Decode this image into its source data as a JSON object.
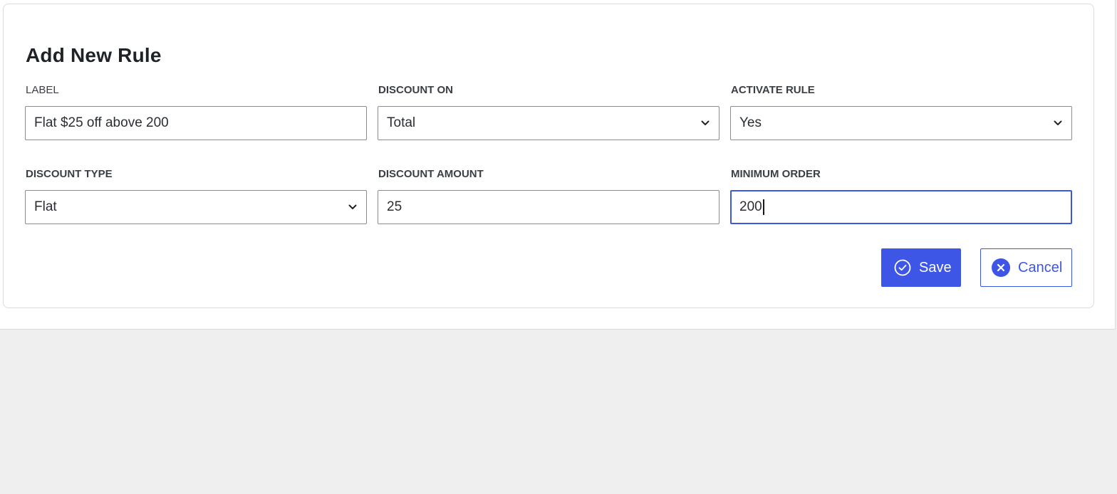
{
  "form": {
    "title": "Add New Rule",
    "fields": {
      "label": {
        "label": "LABEL",
        "value": "Flat $25 off above 200"
      },
      "discount_on": {
        "label": "DISCOUNT ON",
        "value": "Total"
      },
      "activate_rule": {
        "label": "ACTIVATE RULE",
        "value": "Yes"
      },
      "discount_type": {
        "label": "DISCOUNT TYPE",
        "value": "Flat"
      },
      "discount_amount": {
        "label": "DISCOUNT AMOUNT",
        "value": "25"
      },
      "minimum_order": {
        "label": "MINIMUM ORDER",
        "value": "200"
      }
    },
    "actions": {
      "save_label": "Save",
      "cancel_label": "Cancel"
    }
  },
  "icons": {
    "select_arrow": "chevron-down-icon",
    "save": "check-circle-icon",
    "cancel": "close-circle-icon"
  },
  "colors": {
    "accent": "#3d56e6",
    "page_background": "#efefef",
    "card_background": "#ffffff"
  }
}
